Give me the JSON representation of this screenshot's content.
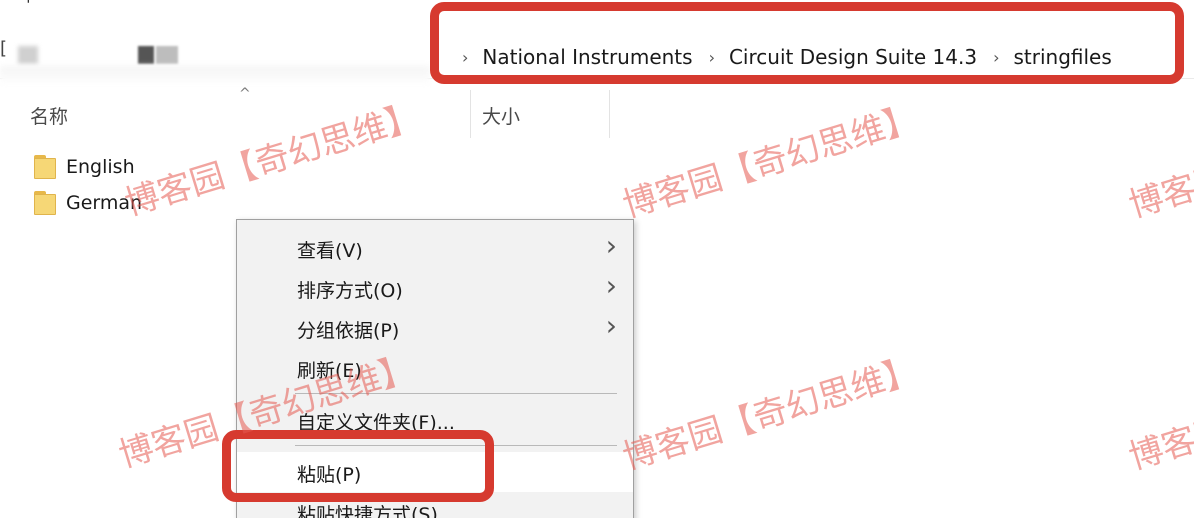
{
  "address_bar": {
    "breadcrumbs": [
      "National Instruments",
      "Circuit Design Suite 14.3",
      "stringfiles"
    ],
    "separator": "›"
  },
  "columns": {
    "name": "名称",
    "size": "大小"
  },
  "files": [
    {
      "name": "English",
      "icon": "folder-icon"
    },
    {
      "name": "German",
      "icon": "folder-icon"
    }
  ],
  "context_menu": {
    "items": [
      {
        "label": "查看(V)",
        "submenu": true
      },
      {
        "label": "排序方式(O)",
        "submenu": true
      },
      {
        "label": "分组依据(P)",
        "submenu": true
      },
      {
        "label": "刷新(E)",
        "submenu": false
      },
      {
        "label": "自定义文件夹(F)...",
        "submenu": false
      },
      {
        "label": "粘贴(P)",
        "submenu": false
      },
      {
        "label": "粘贴快捷方式(S)",
        "submenu": false
      }
    ]
  },
  "watermarks": {
    "text": "博客园【奇幻思维】",
    "partial": "博客园"
  },
  "colors": {
    "annotation": "#d63a2f",
    "watermark": "#e65a50",
    "menu_bg": "#f2f2f2",
    "folder": "#f6d776"
  }
}
